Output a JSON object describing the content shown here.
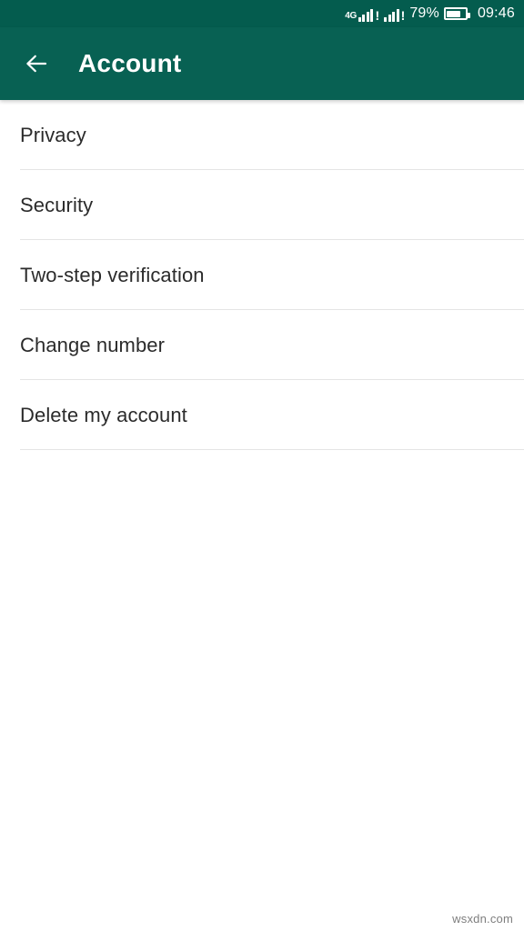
{
  "status_bar": {
    "network_label": "4G",
    "sim1_alert": "!",
    "sim2_alert": "!",
    "battery_percent": "79%",
    "clock": "09:46",
    "background_color": "#045c4e",
    "foreground_color": "#ffffff"
  },
  "app_bar": {
    "title": "Account",
    "back_icon": "arrow-left-icon",
    "background_color": "#086153",
    "title_color": "#ffffff"
  },
  "list": {
    "items": [
      {
        "label": "Privacy"
      },
      {
        "label": "Security"
      },
      {
        "label": "Two-step verification"
      },
      {
        "label": "Change number"
      },
      {
        "label": "Delete my account"
      }
    ],
    "text_color": "#2b2b2b",
    "divider_color": "#e4e4e4",
    "background_color": "#ffffff"
  },
  "watermark": {
    "text": "wsxdn.com",
    "color": "#7e7e7e"
  },
  "ghost_text": "                                                \n                                                \n                                                \n                                                \n                                                \n                                                "
}
